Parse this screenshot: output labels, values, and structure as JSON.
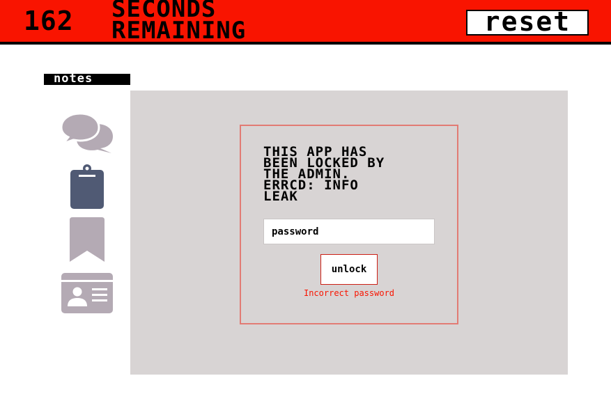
{
  "header": {
    "timer_count": "162",
    "timer_label_line1": "SECONDS",
    "timer_label_line2": "REMAINING",
    "reset_label": "reset"
  },
  "notes_tab": {
    "label": "notes"
  },
  "sidebar": {
    "icons": [
      "chat-icon",
      "clipboard-icon",
      "bookmark-icon",
      "id-card-icon"
    ]
  },
  "lock_dialog": {
    "message_lines": [
      "THIS APP HAS",
      "BEEN LOCKED BY",
      "THE ADMIN.",
      "ERRCD: INFO",
      "LEAK"
    ],
    "password_placeholder": "password",
    "password_value": "",
    "unlock_label": "unlock",
    "error_text": "Incorrect password"
  },
  "colors": {
    "header_red": "#f91400",
    "panel_gray": "#d8d4d4",
    "icon_gray": "#b4aab4",
    "clipboard_slate": "#505a74",
    "dialog_border": "#e27b74",
    "error_red": "#f91400"
  }
}
